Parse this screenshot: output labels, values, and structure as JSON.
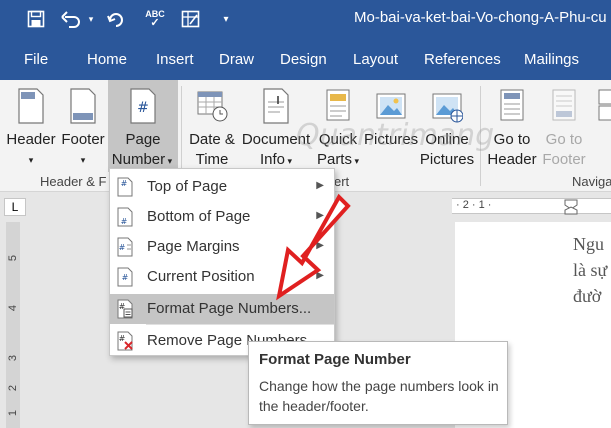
{
  "window": {
    "title": "Mo-bai-va-ket-bai-Vo-chong-A-Phu-cu"
  },
  "quick_access": {
    "save": "save-icon",
    "undo": "undo-icon",
    "redo": "redo-icon",
    "spelling": "ABC",
    "table": "table-icon"
  },
  "tabs": [
    "File",
    "Home",
    "Insert",
    "Draw",
    "Design",
    "Layout",
    "References",
    "Mailings"
  ],
  "ribbon": {
    "header": {
      "label": "Header"
    },
    "footer": {
      "label": "Footer"
    },
    "page_number": {
      "line1": "Page",
      "line2": "Number"
    },
    "group1_label": "Header & F",
    "date_time": {
      "line1": "Date &",
      "line2": "Time"
    },
    "document_info": {
      "line1": "Document",
      "line2": "Info"
    },
    "quick_parts": {
      "line1": "Quick",
      "line2": "Parts"
    },
    "pictures": {
      "line1": "Pictures"
    },
    "online_pictures": {
      "line1": "Online",
      "line2": "Pictures"
    },
    "group2_label": "ert",
    "goto_header": {
      "line1": "Go to",
      "line2": "Header"
    },
    "goto_footer": {
      "line1": "Go to",
      "line2": "Footer"
    },
    "group3_label": "Naviga"
  },
  "watermark": "Quantrimang",
  "ruler": {
    "corner": "L",
    "h_marks": "· 2 · 1 · ",
    "v_marks": [
      "5",
      "4",
      "3",
      "2",
      "1"
    ]
  },
  "document": {
    "lines": [
      "Ngu",
      "là sự",
      "đườ"
    ]
  },
  "menu": {
    "items": [
      {
        "label": "Top of Page",
        "icon": "page-top-icon"
      },
      {
        "label": "Bottom of Page",
        "icon": "page-bottom-icon"
      },
      {
        "label": "Page Margins",
        "icon": "page-margins-icon"
      },
      {
        "label": "Current Position",
        "icon": "current-position-icon"
      },
      {
        "label": "Format Page Numbers...",
        "icon": "format-page-numbers-icon"
      },
      {
        "label": "Remove Page Numbers",
        "icon": "remove-page-numbers-icon"
      }
    ]
  },
  "tooltip": {
    "title": "Format Page Number",
    "body": "Change how the page numbers look in the header/footer."
  },
  "colors": {
    "title_bar": "#2b579a",
    "arrow": "#e02020",
    "highlight": "#c5c5c5"
  }
}
